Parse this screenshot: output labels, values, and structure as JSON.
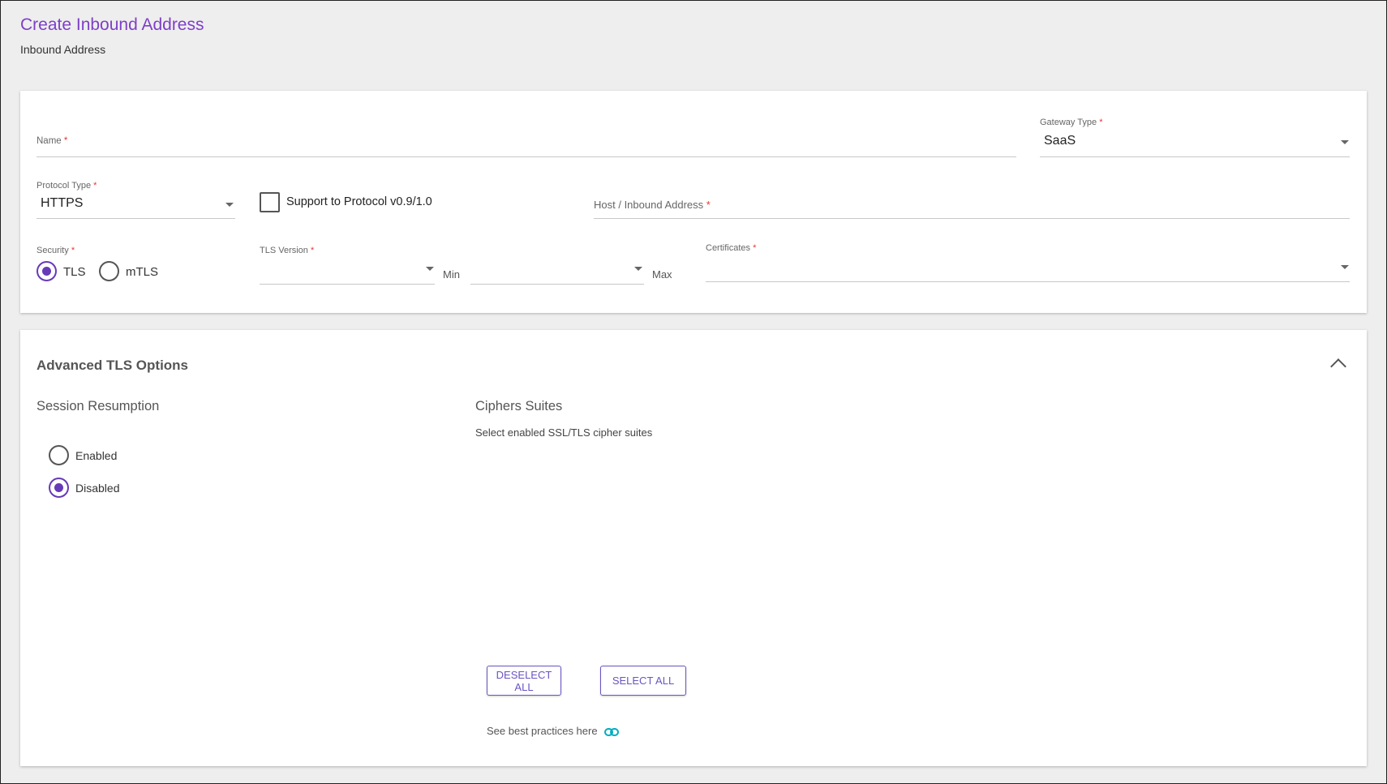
{
  "header": {
    "title": "Create Inbound Address",
    "subtitle": "Inbound Address"
  },
  "colors": {
    "accent": "#673ab7",
    "required": "#e53935",
    "link_icon": "#00acc1"
  },
  "form": {
    "name": {
      "label": "Name",
      "required": "*",
      "value": ""
    },
    "gateway_type": {
      "label": "Gateway Type",
      "required": "*",
      "value": "SaaS"
    },
    "protocol_type": {
      "label": "Protocol Type",
      "required": "*",
      "value": "HTTPS"
    },
    "support_protocol": {
      "label": "Support to Protocol v0.9/1.0",
      "checked": false
    },
    "host": {
      "label": "Host / Inbound Address",
      "required": "*",
      "value": ""
    },
    "security": {
      "label": "Security",
      "required": "*",
      "options": [
        "TLS",
        "mTLS"
      ],
      "selected": "TLS"
    },
    "tls_version": {
      "label": "TLS Version",
      "required": "*",
      "min_label": "Min",
      "max_label": "Max",
      "min_value": "",
      "max_value": ""
    },
    "certificates": {
      "label": "Certificates",
      "required": "*",
      "value": ""
    }
  },
  "advanced": {
    "title": "Advanced TLS Options",
    "session_resumption": {
      "title": "Session Resumption",
      "options": [
        "Enabled",
        "Disabled"
      ],
      "selected": "Disabled"
    },
    "ciphers": {
      "title": "Ciphers Suites",
      "description": "Select enabled SSL/TLS cipher suites",
      "deselect_all": "DESELECT ALL",
      "select_all": "SELECT ALL",
      "best_practices": "See best practices here"
    }
  }
}
